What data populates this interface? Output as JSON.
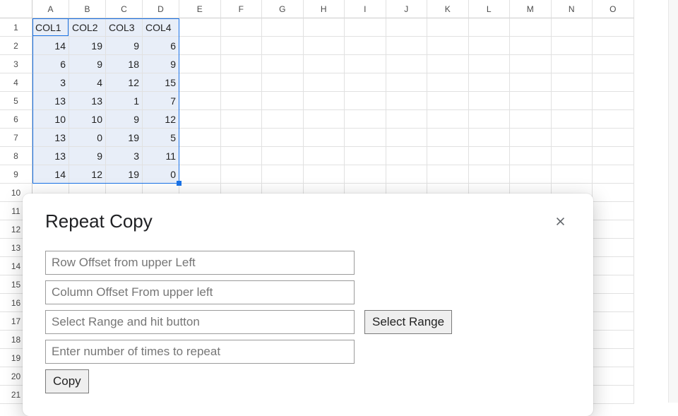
{
  "columns": [
    "A",
    "B",
    "C",
    "D",
    "E",
    "F",
    "G",
    "H",
    "I",
    "J",
    "K",
    "L",
    "M",
    "N",
    "O"
  ],
  "visibleRowCount": 21,
  "dataColumnCount": 4,
  "headers": [
    "COL1",
    "COL2",
    "COL3",
    "COL4"
  ],
  "rows": [
    [
      14,
      19,
      9,
      6
    ],
    [
      6,
      9,
      18,
      9
    ],
    [
      3,
      4,
      12,
      15
    ],
    [
      13,
      13,
      1,
      7
    ],
    [
      10,
      10,
      9,
      12
    ],
    [
      13,
      0,
      19,
      5
    ],
    [
      13,
      9,
      3,
      11
    ],
    [
      14,
      12,
      19,
      0
    ]
  ],
  "dialog": {
    "title": "Repeat Copy",
    "fields": {
      "rowOffset": "Row Offset from upper Left",
      "colOffset": "Column Offset From upper left",
      "range": "Select Range and hit button",
      "times": "Enter number of times to repeat"
    },
    "buttons": {
      "selectRange": "Select Range",
      "copy": "Copy"
    }
  },
  "chart_data": {
    "type": "table",
    "title": "",
    "columns": [
      "COL1",
      "COL2",
      "COL3",
      "COL4"
    ],
    "rows": [
      [
        14,
        19,
        9,
        6
      ],
      [
        6,
        9,
        18,
        9
      ],
      [
        3,
        4,
        12,
        15
      ],
      [
        13,
        13,
        1,
        7
      ],
      [
        10,
        10,
        9,
        12
      ],
      [
        13,
        0,
        19,
        5
      ],
      [
        13,
        9,
        3,
        11
      ],
      [
        14,
        12,
        19,
        0
      ]
    ]
  }
}
